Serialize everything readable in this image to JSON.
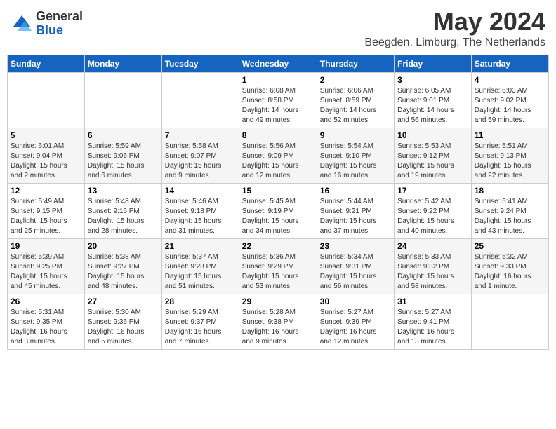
{
  "header": {
    "logo": {
      "general": "General",
      "blue": "Blue"
    },
    "month": "May 2024",
    "location": "Beegden, Limburg, The Netherlands"
  },
  "weekdays": [
    "Sunday",
    "Monday",
    "Tuesday",
    "Wednesday",
    "Thursday",
    "Friday",
    "Saturday"
  ],
  "weeks": [
    [
      {
        "day": "",
        "info": ""
      },
      {
        "day": "",
        "info": ""
      },
      {
        "day": "",
        "info": ""
      },
      {
        "day": "1",
        "info": "Sunrise: 6:08 AM\nSunset: 8:58 PM\nDaylight: 14 hours\nand 49 minutes."
      },
      {
        "day": "2",
        "info": "Sunrise: 6:06 AM\nSunset: 8:59 PM\nDaylight: 14 hours\nand 52 minutes."
      },
      {
        "day": "3",
        "info": "Sunrise: 6:05 AM\nSunset: 9:01 PM\nDaylight: 14 hours\nand 56 minutes."
      },
      {
        "day": "4",
        "info": "Sunrise: 6:03 AM\nSunset: 9:02 PM\nDaylight: 14 hours\nand 59 minutes."
      }
    ],
    [
      {
        "day": "5",
        "info": "Sunrise: 6:01 AM\nSunset: 9:04 PM\nDaylight: 15 hours\nand 2 minutes."
      },
      {
        "day": "6",
        "info": "Sunrise: 5:59 AM\nSunset: 9:06 PM\nDaylight: 15 hours\nand 6 minutes."
      },
      {
        "day": "7",
        "info": "Sunrise: 5:58 AM\nSunset: 9:07 PM\nDaylight: 15 hours\nand 9 minutes."
      },
      {
        "day": "8",
        "info": "Sunrise: 5:56 AM\nSunset: 9:09 PM\nDaylight: 15 hours\nand 12 minutes."
      },
      {
        "day": "9",
        "info": "Sunrise: 5:54 AM\nSunset: 9:10 PM\nDaylight: 15 hours\nand 16 minutes."
      },
      {
        "day": "10",
        "info": "Sunrise: 5:53 AM\nSunset: 9:12 PM\nDaylight: 15 hours\nand 19 minutes."
      },
      {
        "day": "11",
        "info": "Sunrise: 5:51 AM\nSunset: 9:13 PM\nDaylight: 15 hours\nand 22 minutes."
      }
    ],
    [
      {
        "day": "12",
        "info": "Sunrise: 5:49 AM\nSunset: 9:15 PM\nDaylight: 15 hours\nand 25 minutes."
      },
      {
        "day": "13",
        "info": "Sunrise: 5:48 AM\nSunset: 9:16 PM\nDaylight: 15 hours\nand 28 minutes."
      },
      {
        "day": "14",
        "info": "Sunrise: 5:46 AM\nSunset: 9:18 PM\nDaylight: 15 hours\nand 31 minutes."
      },
      {
        "day": "15",
        "info": "Sunrise: 5:45 AM\nSunset: 9:19 PM\nDaylight: 15 hours\nand 34 minutes."
      },
      {
        "day": "16",
        "info": "Sunrise: 5:44 AM\nSunset: 9:21 PM\nDaylight: 15 hours\nand 37 minutes."
      },
      {
        "day": "17",
        "info": "Sunrise: 5:42 AM\nSunset: 9:22 PM\nDaylight: 15 hours\nand 40 minutes."
      },
      {
        "day": "18",
        "info": "Sunrise: 5:41 AM\nSunset: 9:24 PM\nDaylight: 15 hours\nand 43 minutes."
      }
    ],
    [
      {
        "day": "19",
        "info": "Sunrise: 5:39 AM\nSunset: 9:25 PM\nDaylight: 15 hours\nand 45 minutes."
      },
      {
        "day": "20",
        "info": "Sunrise: 5:38 AM\nSunset: 9:27 PM\nDaylight: 15 hours\nand 48 minutes."
      },
      {
        "day": "21",
        "info": "Sunrise: 5:37 AM\nSunset: 9:28 PM\nDaylight: 15 hours\nand 51 minutes."
      },
      {
        "day": "22",
        "info": "Sunrise: 5:36 AM\nSunset: 9:29 PM\nDaylight: 15 hours\nand 53 minutes."
      },
      {
        "day": "23",
        "info": "Sunrise: 5:34 AM\nSunset: 9:31 PM\nDaylight: 15 hours\nand 56 minutes."
      },
      {
        "day": "24",
        "info": "Sunrise: 5:33 AM\nSunset: 9:32 PM\nDaylight: 15 hours\nand 58 minutes."
      },
      {
        "day": "25",
        "info": "Sunrise: 5:32 AM\nSunset: 9:33 PM\nDaylight: 16 hours\nand 1 minute."
      }
    ],
    [
      {
        "day": "26",
        "info": "Sunrise: 5:31 AM\nSunset: 9:35 PM\nDaylight: 16 hours\nand 3 minutes."
      },
      {
        "day": "27",
        "info": "Sunrise: 5:30 AM\nSunset: 9:36 PM\nDaylight: 16 hours\nand 5 minutes."
      },
      {
        "day": "28",
        "info": "Sunrise: 5:29 AM\nSunset: 9:37 PM\nDaylight: 16 hours\nand 7 minutes."
      },
      {
        "day": "29",
        "info": "Sunrise: 5:28 AM\nSunset: 9:38 PM\nDaylight: 16 hours\nand 9 minutes."
      },
      {
        "day": "30",
        "info": "Sunrise: 5:27 AM\nSunset: 9:39 PM\nDaylight: 16 hours\nand 12 minutes."
      },
      {
        "day": "31",
        "info": "Sunrise: 5:27 AM\nSunset: 9:41 PM\nDaylight: 16 hours\nand 13 minutes."
      },
      {
        "day": "",
        "info": ""
      }
    ]
  ]
}
